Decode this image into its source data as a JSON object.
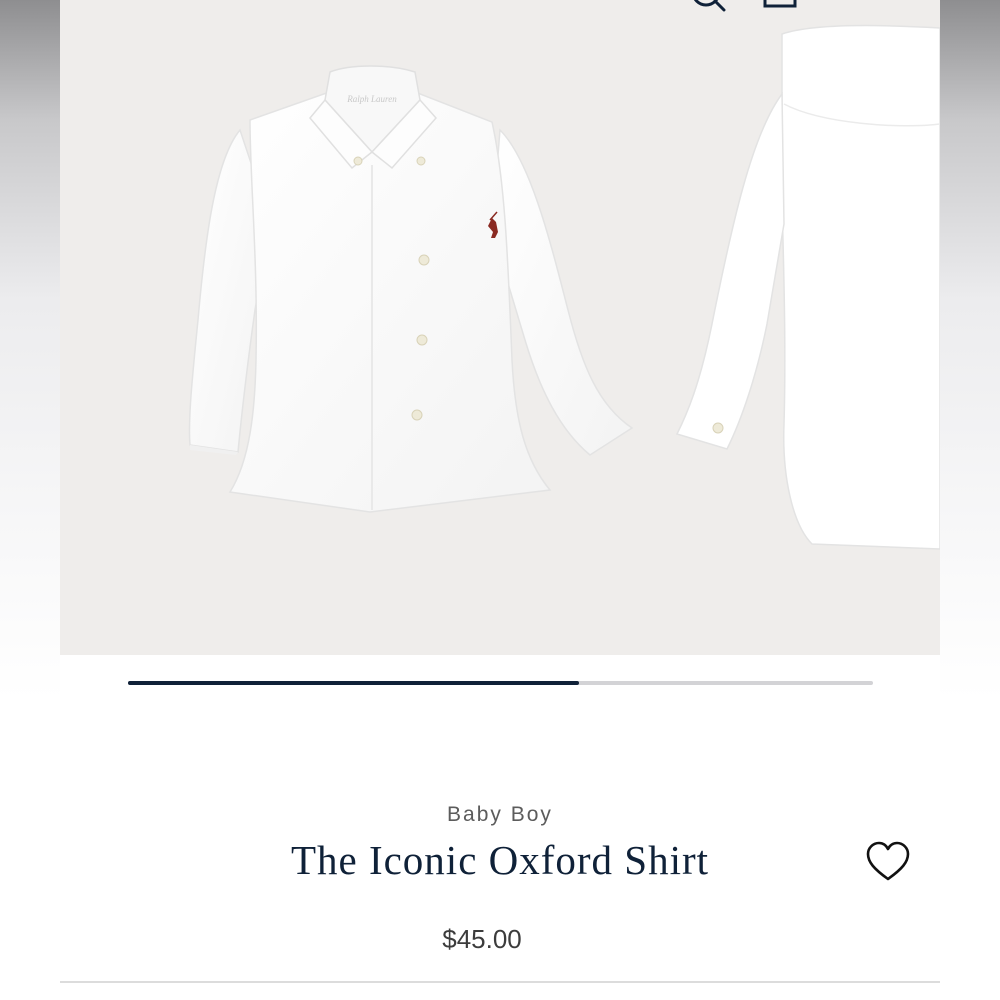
{
  "header": {
    "icons": [
      "search-icon",
      "shopping-bag-icon",
      "menu-icon"
    ]
  },
  "gallery": {
    "images": [
      "front view of white oxford shirt",
      "back view of white oxford shirt"
    ],
    "progress": 0.605
  },
  "product": {
    "category": "Baby Boy",
    "title": "The Iconic Oxford Shirt",
    "price": "$45.00",
    "wishlist_icon": "heart-icon"
  },
  "colors": {
    "navy": "#0f2138",
    "gallery_bg": "#efedeb",
    "track": "#d3d3d6",
    "logo": "#8a2a22"
  }
}
